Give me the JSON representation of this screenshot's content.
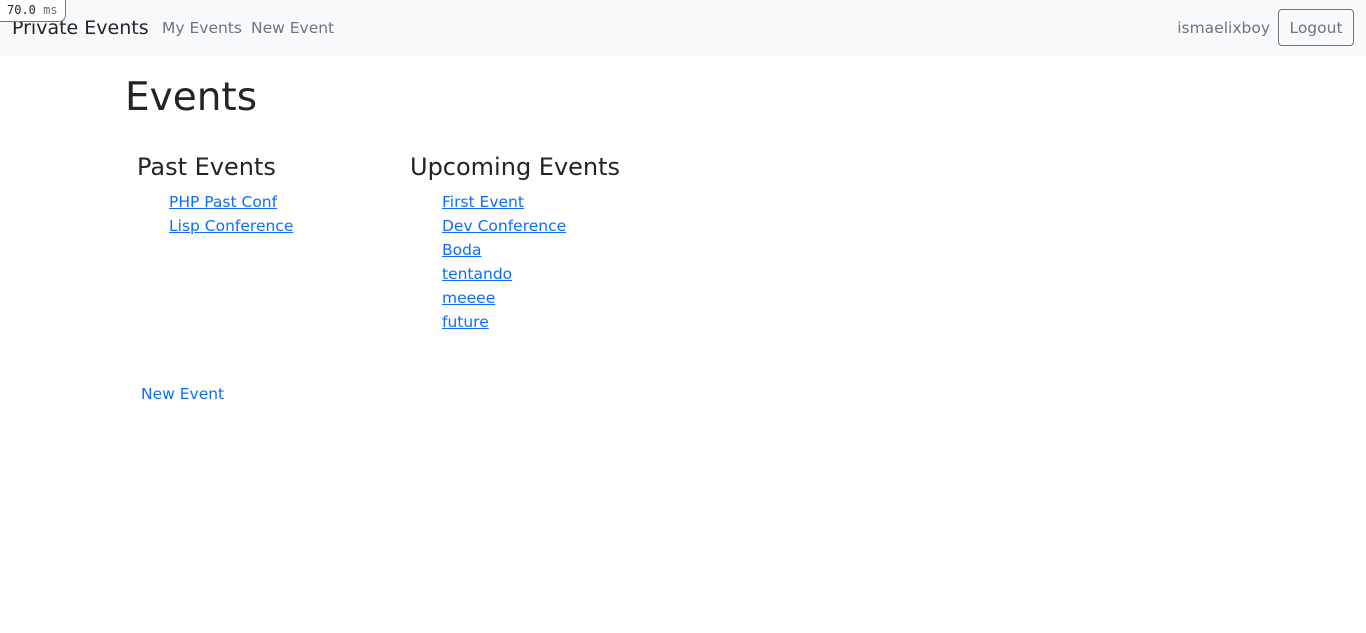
{
  "timing": {
    "value": "70.0",
    "unit": "ms"
  },
  "navbar": {
    "brand": "Private Events",
    "links": [
      "My Events",
      "New Event"
    ],
    "username": "ismaelixboy",
    "logout_label": "Logout"
  },
  "main": {
    "title": "Events",
    "past": {
      "heading": "Past Events",
      "items": [
        "PHP Past Conf",
        "Lisp Conference"
      ]
    },
    "upcoming": {
      "heading": "Upcoming Events",
      "items": [
        "First Event",
        "Dev Conference",
        "Boda",
        "tentando",
        "meeee",
        "future"
      ]
    },
    "new_event_link": "New Event"
  },
  "colors": {
    "link": "#0d6efd",
    "nav_text": "#6c757d",
    "navbar_bg": "#f8f9fa",
    "text": "#212529"
  }
}
